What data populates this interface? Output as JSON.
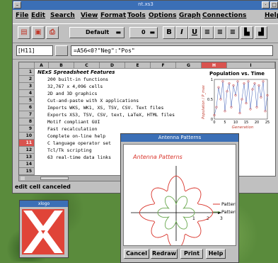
{
  "window": {
    "title": "nt.xs3"
  },
  "menu": [
    "File",
    "Edit",
    "Search",
    "View",
    "Format",
    "Tools",
    "Options",
    "Graph",
    "Connections",
    "Help"
  ],
  "toolbar": {
    "font": "Default",
    "size": "0",
    "bold": "B",
    "italic": "I",
    "underline": "U"
  },
  "entry": {
    "cell_ref": "[H11]",
    "formula": "=A56<0?\"Neg\":\"Pos\""
  },
  "sheet": {
    "columns": [
      "A",
      "B",
      "C",
      "D",
      "E",
      "F",
      "G",
      "H",
      "I"
    ],
    "selected_column": "H",
    "rows": [
      {
        "n": "1",
        "text": "NExS Spreadsheet Features"
      },
      {
        "n": "2",
        "text": "200 built-in functions"
      },
      {
        "n": "3",
        "text": "32,767 x 4,096 cells"
      },
      {
        "n": "4",
        "text": "2D and 3D graphics"
      },
      {
        "n": "5",
        "text": "Cut-and-paste with X applications"
      },
      {
        "n": "6",
        "text": "Imports WKS, WK1, XS, TSV, CSV. Text files"
      },
      {
        "n": "7",
        "text": "Exports XS3, TSV, CSV, text, LaTeX, HTML files"
      },
      {
        "n": "8",
        "text": "Motif compliant GUI"
      },
      {
        "n": "9",
        "text": "Fast recalculation"
      },
      {
        "n": "10",
        "text": "Complete on-line help"
      },
      {
        "n": "11",
        "text": "C language operator set"
      },
      {
        "n": "12",
        "text": "Tcl/Tk scripting"
      },
      {
        "n": "13",
        "text": "63 real-time data links"
      },
      {
        "n": "14",
        "text": ""
      },
      {
        "n": "15",
        "text": ""
      }
    ],
    "selected_row": "11"
  },
  "status": "edit cell canceled",
  "mini_chart": {
    "title": "Population vs. Time",
    "xlabel": "Generation",
    "ylabel": "Population / P_max",
    "xticks": [
      "0",
      "5",
      "10",
      "15",
      "20",
      "25"
    ],
    "yticks": [
      "0",
      "0.5",
      "1"
    ]
  },
  "dialog": {
    "title": "Antenna Patterns",
    "plot_title": "Antenna Patterns",
    "legend": [
      "Pattern 1",
      "Pattern 2"
    ],
    "axis_labels": [
      "1",
      "2",
      "3"
    ],
    "buttons": [
      "Cancel",
      "Redraw",
      "Print",
      "Help"
    ],
    "colors": {
      "pattern1": "#d9342b",
      "pattern2": "#6aa84f"
    }
  },
  "xlogo": {
    "title": "xlogo"
  },
  "chart_data": {
    "type": "line",
    "title": "Population vs. Time",
    "xlabel": "Generation",
    "ylabel": "Population / P_max",
    "x": [
      0,
      1,
      2,
      3,
      4,
      5,
      6,
      7,
      8,
      9,
      10,
      11,
      12,
      13,
      14,
      15,
      16,
      17,
      18,
      19,
      20,
      21,
      22,
      23,
      24,
      25
    ],
    "series": [
      {
        "values": [
          0.1,
          0.3,
          0.8,
          0.5,
          0.95,
          0.2,
          0.7,
          0.9,
          0.3,
          0.85,
          0.6,
          0.95,
          0.15,
          0.5,
          0.9,
          0.4,
          0.95,
          0.25,
          0.75,
          0.9,
          0.3,
          0.85,
          0.55,
          0.95,
          0.2,
          0.6
        ]
      }
    ],
    "ylim": [
      0,
      1
    ],
    "xlim": [
      0,
      25
    ]
  }
}
